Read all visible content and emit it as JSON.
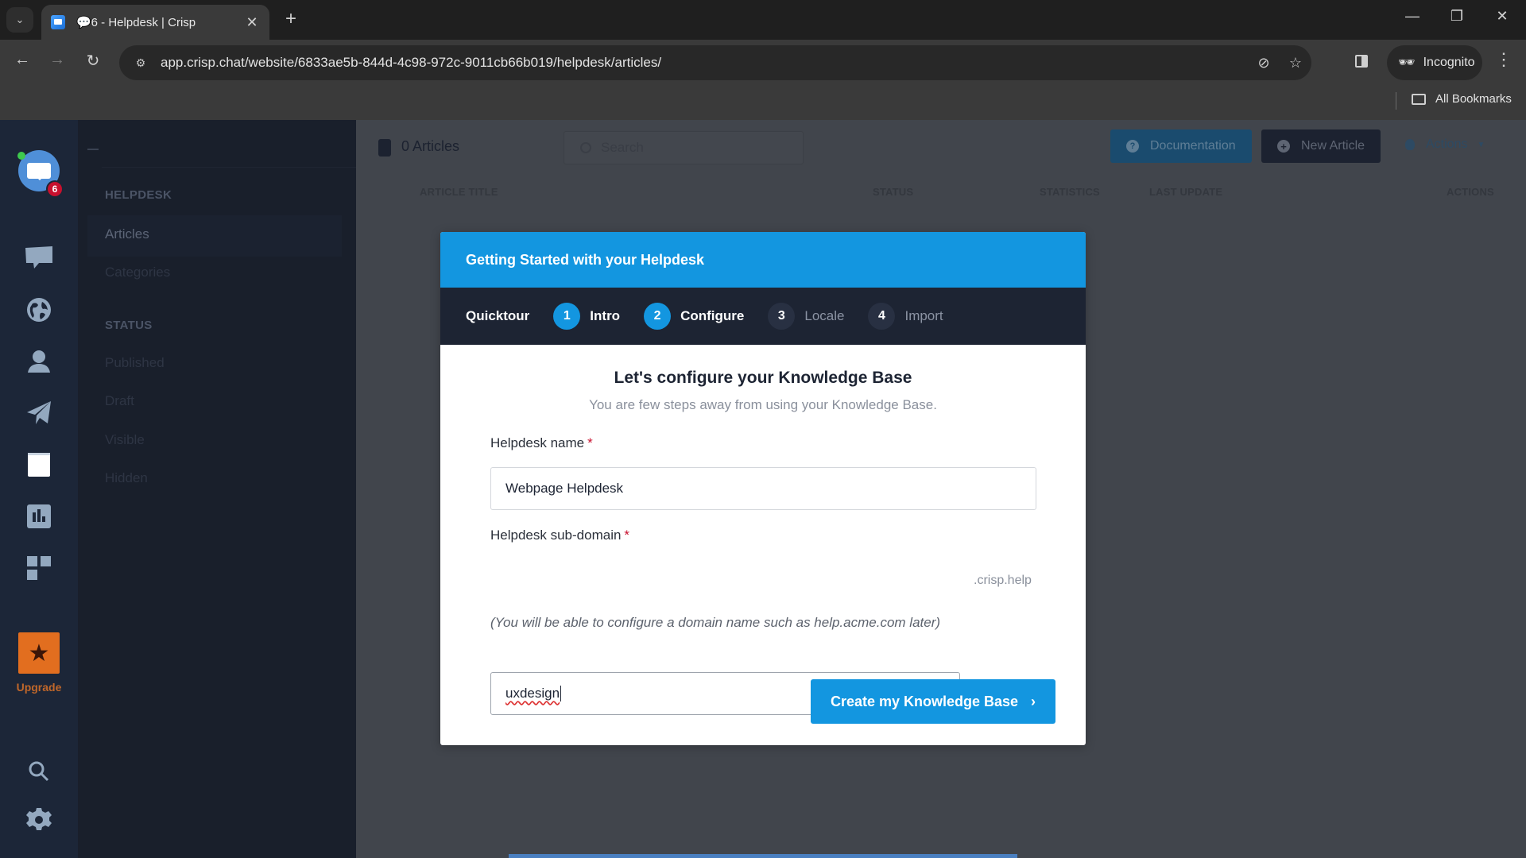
{
  "browser": {
    "tab_title": "💬6 - Helpdesk | Crisp",
    "url": "app.crisp.chat/website/6833ae5b-844d-4c98-972c-9011cb66b019/helpdesk/articles/",
    "profile_label": "Incognito",
    "bookmarks_label": "All Bookmarks",
    "icons": {
      "tab_search": "⌄",
      "close": "✕",
      "new_tab": "+",
      "minimize": "—",
      "restore": "❐",
      "window_close": "✕",
      "back": "←",
      "forward": "→",
      "reload": "↻",
      "site_settings": "⚙",
      "eye_off": "⊘",
      "star": "☆",
      "incognito": "🕶",
      "kebab": "⋮"
    }
  },
  "rail": {
    "unread_badge": "6",
    "upgrade_label": "Upgrade",
    "upgrade_icon": "★",
    "items": [
      "inbox",
      "visitors",
      "contacts",
      "campaigns",
      "helpdesk",
      "analytics",
      "plugins",
      "search",
      "settings"
    ]
  },
  "subnav": {
    "section_helpdesk": "HELPDESK",
    "items_helpdesk": [
      "Articles",
      "Categories"
    ],
    "section_status": "STATUS",
    "items_status": [
      "Published",
      "Draft",
      "Visible",
      "Hidden"
    ]
  },
  "main": {
    "article_count": "0 Articles",
    "search_placeholder": "Search",
    "documentation_label": "Documentation",
    "new_article_label": "New Article",
    "actions_label": "Actions",
    "columns": [
      "ARTICLE TITLE",
      "STATUS",
      "STATISTICS",
      "LAST UPDATE",
      "ACTIONS"
    ]
  },
  "modal": {
    "header_title": "Getting Started with your Helpdesk",
    "quicktour_label": "Quicktour",
    "steps": [
      {
        "num": "1",
        "label": "Intro",
        "state": "done"
      },
      {
        "num": "2",
        "label": "Configure",
        "state": "done"
      },
      {
        "num": "3",
        "label": "Locale",
        "state": "todo"
      },
      {
        "num": "4",
        "label": "Import",
        "state": "todo"
      }
    ],
    "title": "Let's configure your Knowledge Base",
    "subtitle": "You are few steps away from using your Knowledge Base.",
    "name_label": "Helpdesk name",
    "name_value": "Webpage Helpdesk",
    "subdomain_label": "Helpdesk sub-domain",
    "subdomain_value": "uxdesign",
    "subdomain_suffix": ".crisp.help",
    "required_mark": "*",
    "hint": "(You will be able to configure a domain name such as help.acme.com later)",
    "cta_label": "Create my Knowledge Base",
    "cta_chevron": "›"
  },
  "colors": {
    "accent": "#1396e0",
    "steps_bar": "#1d2433",
    "upgrade": "#e26e1f",
    "badge": "#c8102e"
  }
}
